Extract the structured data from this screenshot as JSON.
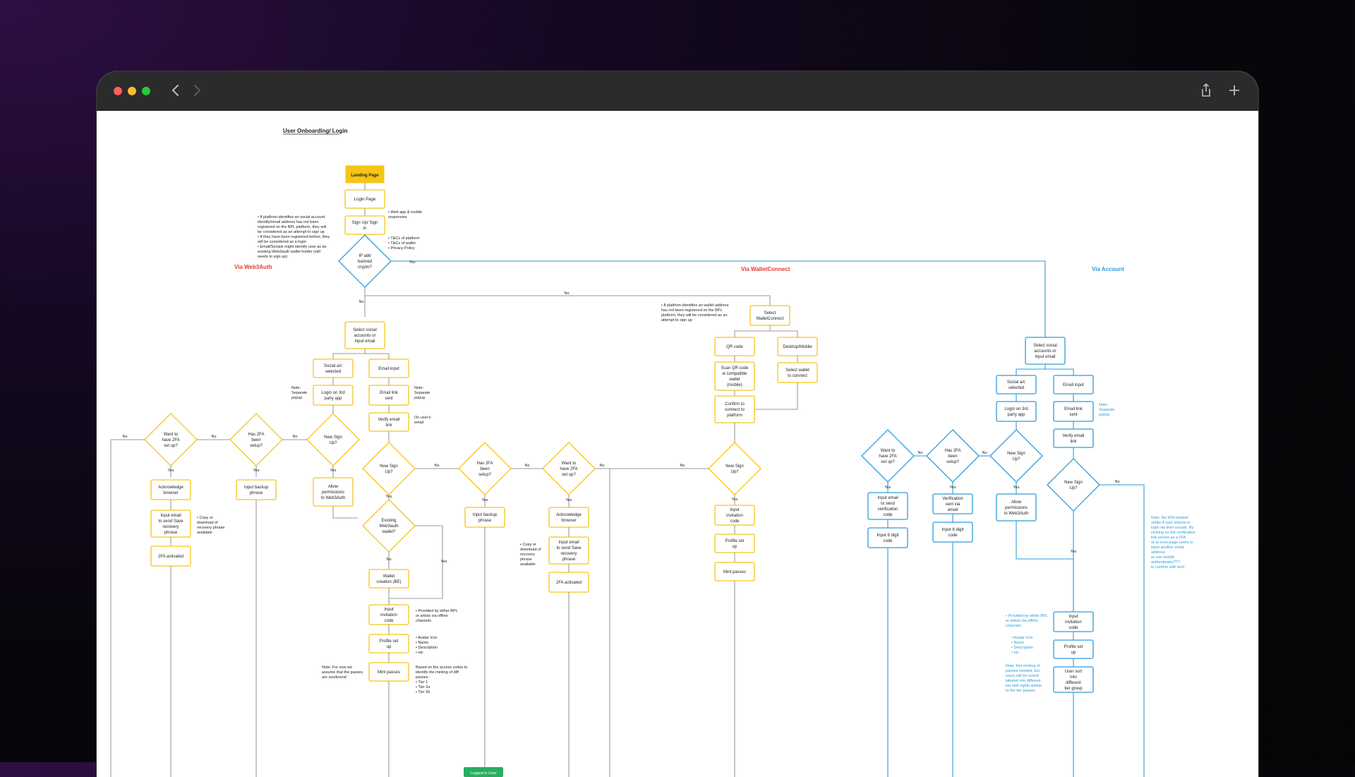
{
  "colors": {
    "yellow": "#f5c518",
    "blue": "#2d9cdb",
    "red": "#e53935",
    "green": "#27ae60",
    "grey": "#9a9a9a"
  },
  "titlebar": {
    "icons": [
      "back-icon",
      "forward-icon",
      "share-icon",
      "new-tab-icon"
    ]
  },
  "diagram": {
    "title": "User Onboarding/ Login",
    "section_web3auth": "Via Web3Auth",
    "section_walletconnect": "Via WalletConnect",
    "section_account": "Via Account",
    "landing": "Landing Page",
    "login": "Login Page",
    "signup": "Sign Up/ Sign in",
    "ip_q": "IP add banned crypto?",
    "select_social": "Select social accounts or input email",
    "social_sel": "Social a/c selected",
    "login3rd": "Login on 3rd party app",
    "email_input": "Email input",
    "email_link": "Email link sent",
    "verify": "Verify email link",
    "new_signup": "New Sign Up?",
    "has2fa": "Has 2FA been setup?",
    "want2fa": "Want to have 2FA set up?",
    "allow_perm": "Allow permissions to Web3Auth",
    "input_backup": "Input backup phrase",
    "ack_browser": "Acknowledge browser",
    "input_email_save": "Input email to send Save recovery phrase",
    "fa_activated": "2FA activated",
    "existing": "Existing Web3auth wallet?",
    "wallet_creation": "Wallet creation (BE)",
    "invite": "Input invitation code",
    "profile": "Profile set up",
    "mint": "Mint passes",
    "logged": "Logged in User",
    "select_wc": "Select WalletConnect",
    "qr": "QR code",
    "desktop": "Desktop/Mobile",
    "scan": "Scan QR code w compatible wallet (mobile)",
    "select_wallet": "Select wallet to connect",
    "confirm": "Confirm to connect to platform",
    "input_email_verif": "Input email to send verification code",
    "input6": "Input 6 digit code",
    "verif_sent": "Verification sent via email",
    "sort": "User sort into different tier group",
    "yes": "Yes",
    "no": "No",
    "notes": {
      "platform": [
        "• If platform identifies an social account",
        "identify/email address has not been",
        "registered on the BPL platform, they will",
        "be considered as an attempt to sign up",
        "• If they have been registered before, they",
        "will be considered as a login",
        "• Email/Socials might identify user as an",
        "existing Web3auth wallet holder (still",
        "needs to sign up)"
      ],
      "webapp": [
        "• Web app & mobile",
        "responsive"
      ],
      "tcs": [
        "• T&Cs of platform",
        "• T&Cs of wallet",
        "• Privacy Policy"
      ],
      "wc_platform": [
        "• If platform identifies an wallet address",
        "has not been registered on the BPL",
        "platform, they will be considered as an",
        "attempt to sign up"
      ],
      "sep_popup": [
        "Note:",
        "Separate",
        "popup"
      ],
      "on_email": [
        "On user's",
        "email"
      ],
      "copy": [
        "• Copy or",
        "download of",
        "recovery phrase",
        "available"
      ],
      "copy2": [
        "• Copy or",
        "download of",
        "recovery",
        "phrase",
        "available"
      ],
      "provided": [
        "• Provided by either BPL",
        "or artists via offline",
        "channels"
      ],
      "avatar": [
        "• Avatar icon",
        "• Name",
        "• Description",
        "• etc"
      ],
      "soulbound": [
        "Note: For now we",
        "assume that the passes",
        "are soulbound"
      ],
      "access": [
        "Based on the access codes to",
        "identify the minting of diff",
        "passes:",
        "• Tier 1",
        "• Tier 2a",
        "• Tier 2b"
      ],
      "acct_sep": [
        "Note:",
        "Separate",
        "popup"
      ],
      "acct_2fa": [
        "Note: No 2FA needed",
        "unlike if user selects to",
        "login via their socials. By",
        "clicking on the verification",
        "link serves as a 2FA",
        "",
        "or to encourage users to",
        "input another email",
        "address",
        "",
        "or use mobile",
        "authenticator???",
        "",
        "to confirm with tech"
      ],
      "acct_provided": [
        "• Provided by either BPL",
        "or artists via offline",
        "channels"
      ],
      "acct_avatar": [
        "• Avatar icon",
        "• Name",
        "• Description",
        "• etc"
      ],
      "acct_minting": [
        "Note: Not minting of",
        "passes needed, but",
        "users will be sorted",
        "labeled into different",
        "tier with rights similar",
        "to the tier passes"
      ]
    }
  }
}
